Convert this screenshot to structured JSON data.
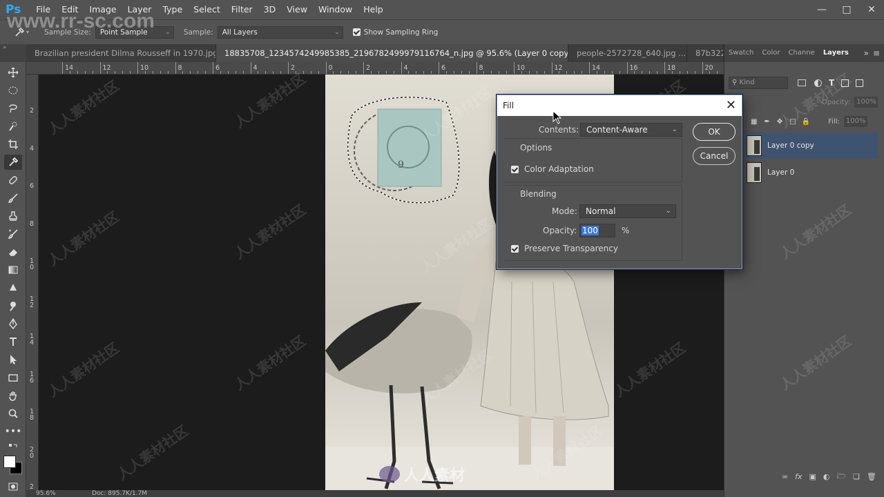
{
  "app": {
    "logo": "Ps",
    "menu": [
      "File",
      "Edit",
      "Image",
      "Layer",
      "Type",
      "Select",
      "Filter",
      "3D",
      "View",
      "Window",
      "Help"
    ]
  },
  "options_bar": {
    "sample_size_label": "Sample Size:",
    "sample_size_value": "Point Sample",
    "sample_label": "Sample:",
    "sample_value": "All Layers",
    "show_sampling_ring_label": "Show Sampling Ring",
    "show_sampling_ring_checked": true
  },
  "tabs": [
    {
      "label": "Brazilian president Dilma Rousseff in 1970.jpg",
      "active": false
    },
    {
      "label": "18835708_1234574249985385_2196782499979116764_n.jpg @ 95.6% (Layer 0 copy, RGB/8) *",
      "active": true
    },
    {
      "label": "people-2572728_640.jpg ...",
      "active": false
    },
    {
      "label": "87b322l",
      "active": false
    }
  ],
  "ruler": {
    "top_labels": [
      "14",
      "12",
      "10",
      "8",
      "6",
      "4",
      "2",
      "0",
      "2",
      "4",
      "6",
      "8",
      "10",
      "12",
      "14",
      "16",
      "18",
      "20"
    ],
    "left_labels": [
      "2",
      "4",
      "6",
      "8",
      "1\n0",
      "1\n2",
      "1\n4",
      "1\n6",
      "1\n8",
      "2\n0",
      "2\n2"
    ]
  },
  "status_bar": {
    "zoom": "95.6%",
    "doc": "Doc: 895.7K/1.7M"
  },
  "panels": {
    "tabs": [
      "Swatch",
      "Color",
      "Channe",
      "Layers"
    ],
    "active_tab": "Layers",
    "kind_placeholder": "Kind",
    "blend_mode": "mal",
    "opacity_label": "Opacity:",
    "opacity_value": "100%",
    "fill_label": "Fill:",
    "fill_value": "100%",
    "layers": [
      {
        "name": "Layer 0 copy",
        "selected": true
      },
      {
        "name": "Layer 0",
        "selected": false
      }
    ]
  },
  "fill_dialog": {
    "title": "Fill",
    "contents_label": "Contents:",
    "contents_value": "Content-Aware",
    "options_heading": "Options",
    "color_adaptation_label": "Color Adaptation",
    "color_adaptation_checked": true,
    "blending_heading": "Blending",
    "mode_label": "Mode:",
    "mode_value": "Normal",
    "opacity_label": "Opacity:",
    "opacity_value": "100",
    "opacity_unit": "%",
    "preserve_transparency_label": "Preserve Transparency",
    "preserve_transparency_checked": true,
    "ok_label": "OK",
    "cancel_label": "Cancel"
  },
  "watermarks": {
    "site": "www.rr-sc.com",
    "brand": "人人素材",
    "repeat": "人人素材社区"
  },
  "icons": [
    "eyedropper-icon",
    "move-icon",
    "marquee-icon",
    "lasso-icon",
    "quick-select-icon",
    "crop-icon",
    "healing-icon",
    "brush-icon",
    "stamp-icon",
    "history-brush-icon",
    "eraser-icon",
    "gradient-icon",
    "blur-icon",
    "dodge-icon",
    "pen-icon",
    "type-icon",
    "path-select-icon",
    "rectangle-icon",
    "hand-icon",
    "zoom-icon",
    "more-icon",
    "swap-colors-icon",
    "quick-mask-icon"
  ],
  "colors": {
    "accent": "#31a8ff",
    "selected_layer": "#3e5370",
    "panel": "#535353",
    "canvas_bg": "#1c1c1c"
  }
}
